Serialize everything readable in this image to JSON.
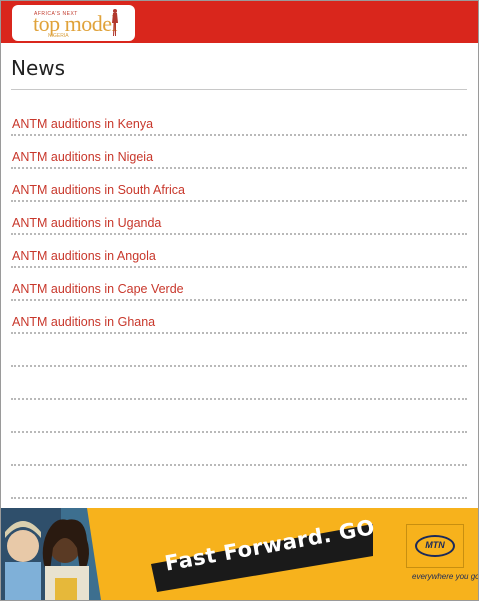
{
  "header": {
    "logo": {
      "small_text": "AFRICA'S NEXT",
      "main_text": "top model",
      "tag_text": "NIGERIA"
    },
    "color": "#d9261c"
  },
  "page": {
    "title": "News"
  },
  "news": {
    "items": [
      {
        "label": "ANTM auditions in Kenya"
      },
      {
        "label": "ANTM auditions in Nigeia"
      },
      {
        "label": "ANTM auditions in South Africa"
      },
      {
        "label": "ANTM auditions in Uganda"
      },
      {
        "label": "ANTM auditions in Angola"
      },
      {
        "label": "ANTM auditions in Cape Verde"
      },
      {
        "label": "ANTM auditions in Ghana"
      },
      {
        "label": ""
      },
      {
        "label": ""
      },
      {
        "label": ""
      },
      {
        "label": ""
      },
      {
        "label": ""
      }
    ],
    "link_color": "#c8372b"
  },
  "ad": {
    "slogan": "Fast Forward. GO",
    "brand": "MTN",
    "tagline": "everywhere you go",
    "background": "#f7b21c"
  }
}
